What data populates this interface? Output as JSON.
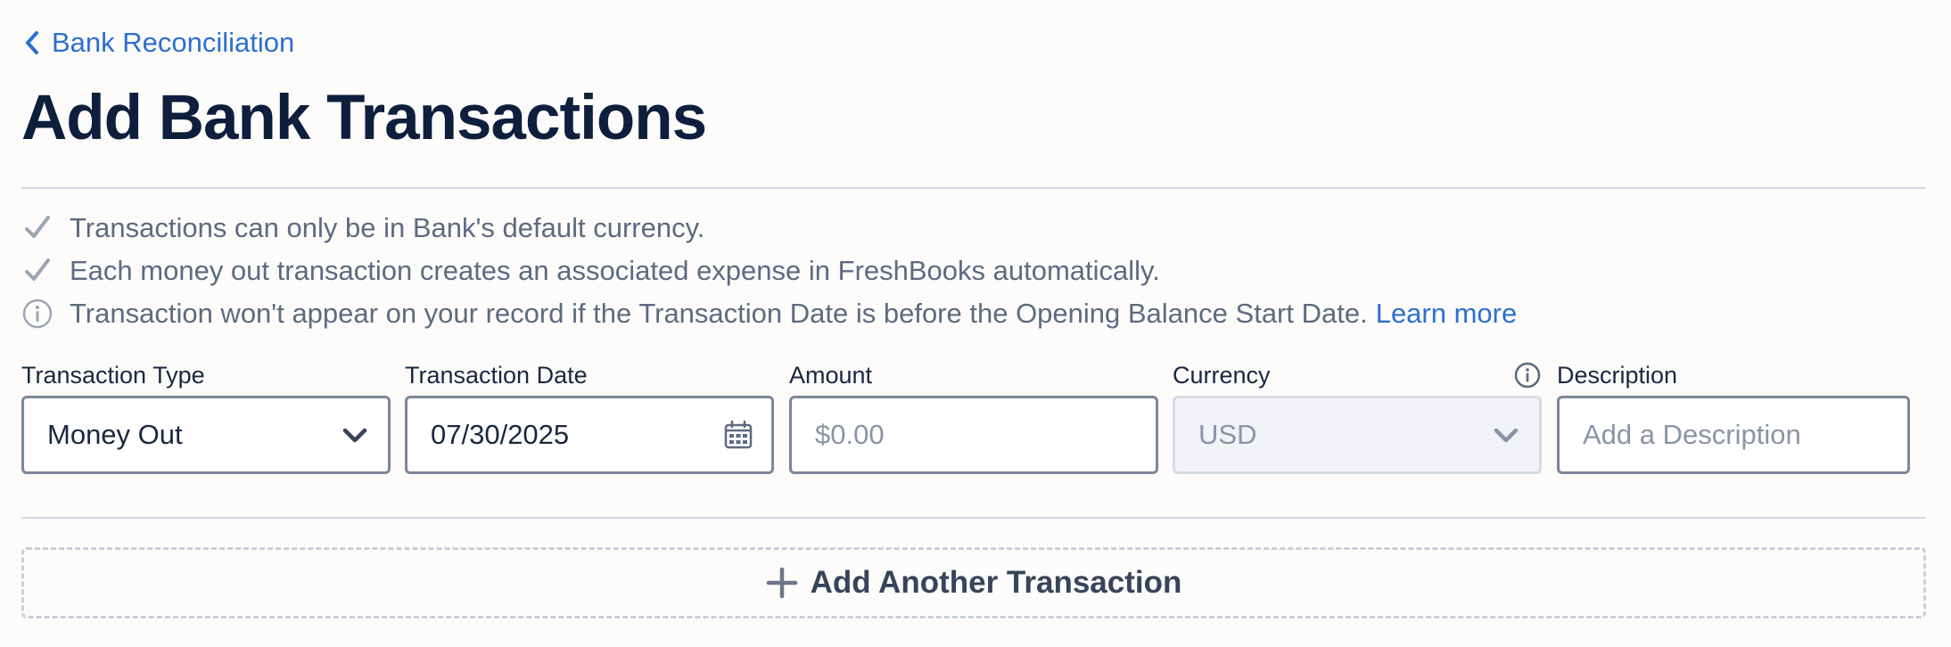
{
  "breadcrumb": {
    "label": "Bank Reconciliation"
  },
  "page": {
    "title": "Add Bank Transactions"
  },
  "notes": {
    "currency": "Transactions can only be in Bank's default currency.",
    "expense": "Each money out transaction creates an associated expense in FreshBooks automatically.",
    "date_warning": "Transaction won't appear on your record if the Transaction Date is before the Opening Balance Start Date.",
    "learn_more": "Learn more"
  },
  "form": {
    "transaction_type": {
      "label": "Transaction Type",
      "value": "Money Out"
    },
    "transaction_date": {
      "label": "Transaction Date",
      "value": "07/30/2025"
    },
    "amount": {
      "label": "Amount",
      "placeholder": "$0.00"
    },
    "currency": {
      "label": "Currency",
      "value": "USD"
    },
    "description": {
      "label": "Description",
      "placeholder": "Add a Description"
    }
  },
  "actions": {
    "add_another": "Add Another Transaction"
  },
  "colors": {
    "link": "#2c6fd1",
    "title": "#0d1f3c",
    "muted": "#5d6a80",
    "border": "#7b8699"
  },
  "icons": {
    "back": "chevron-left-icon",
    "check": "check-icon",
    "info": "info-icon",
    "dropdown": "chevron-down-icon",
    "calendar": "calendar-icon",
    "add": "plus-icon"
  }
}
